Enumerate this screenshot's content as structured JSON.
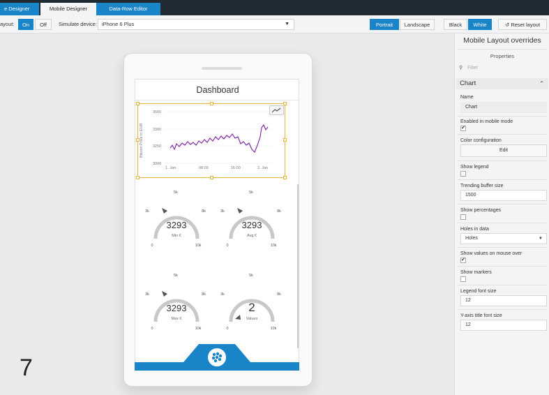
{
  "tabs": [
    {
      "label": "e Designer"
    },
    {
      "label": "Mobile Designer"
    },
    {
      "label": "Data-Row Editor"
    }
  ],
  "toolbar": {
    "layout_label": "ayout:",
    "on_label": "On",
    "off_label": "Off",
    "simulate_label": "Simulate device:",
    "device_value": "iPhone 6 Plus",
    "portrait_label": "Portrait",
    "landscape_label": "Landscape",
    "black_label": "Black",
    "white_label": "White",
    "reset_label": "Reset layout"
  },
  "screen": {
    "title": "Dashboard",
    "chart": {
      "ylabel": "Bitcoin Price in EUR",
      "yticks": [
        "3500",
        "3300",
        "3250",
        "3000"
      ],
      "xticks": [
        "1. Jan",
        "08:00",
        "16:00",
        "2. Jan"
      ]
    },
    "gauges": [
      {
        "value": "3293",
        "label": "Min €",
        "top": "5k",
        "left": "3k",
        "right": "8k",
        "min": "0",
        "max": "10k"
      },
      {
        "value": "3293",
        "label": "Avg €",
        "top": "5k",
        "left": "3k",
        "right": "8k",
        "min": "0",
        "max": "10k"
      },
      {
        "value": "3293",
        "label": "Max €",
        "top": "5k",
        "left": "3k",
        "right": "8k",
        "min": "0",
        "max": "10k"
      },
      {
        "value": "2",
        "label": "Values",
        "top": "5k",
        "left": "3k",
        "right": "8k",
        "min": "0",
        "max": "10k"
      }
    ]
  },
  "page_number": "7",
  "panel": {
    "title": "Mobile Layout overrides",
    "subtitle": "Properties",
    "filter_placeholder": "Filter",
    "section": "Chart",
    "name_label": "Name",
    "name_value": "Chart",
    "enabled_label": "Enabled in mobile mode",
    "color_label": "Color configuration",
    "edit_label": "Edit",
    "show_legend_label": "Show legend",
    "trending_label": "Trending buffer size",
    "trending_value": "1500",
    "show_pct_label": "Show percentages",
    "holes_label": "Holes in data",
    "holes_value": "Holes",
    "show_values_label": "Show values on mouse over",
    "show_markers_label": "Show markers",
    "legend_font_label": "Legend font size",
    "legend_font_value": "12",
    "yaxis_font_label": "Y-axis title font size",
    "yaxis_font_value": "12"
  },
  "colors": {
    "accent": "#1a84c8",
    "selection": "#e8b53b",
    "series": "#7b1fa2"
  }
}
